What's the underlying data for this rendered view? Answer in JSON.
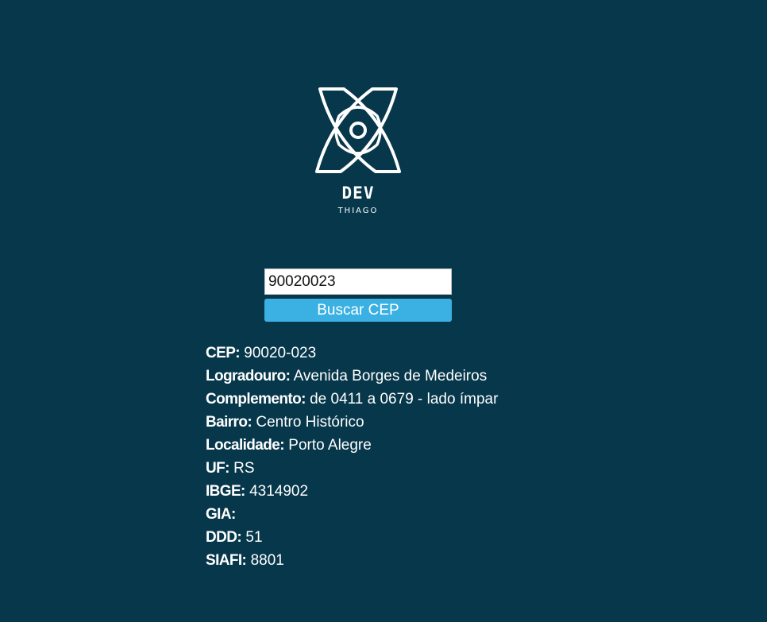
{
  "brand": {
    "name": "DEV",
    "subtitle": "THIAGO",
    "logo_icon": "atom-eye-icon"
  },
  "search": {
    "value": "90020023",
    "button_label": "Buscar CEP"
  },
  "result": [
    {
      "label": "CEP:",
      "value": "90020-023"
    },
    {
      "label": "Logradouro:",
      "value": "Avenida Borges de Medeiros"
    },
    {
      "label": "Complemento:",
      "value": "de 0411 a 0679 - lado ímpar"
    },
    {
      "label": "Bairro:",
      "value": "Centro Histórico"
    },
    {
      "label": "Localidade:",
      "value": "Porto Alegre"
    },
    {
      "label": "UF:",
      "value": "RS"
    },
    {
      "label": "IBGE:",
      "value": "4314902"
    },
    {
      "label": "GIA:",
      "value": ""
    },
    {
      "label": "DDD:",
      "value": "51"
    },
    {
      "label": "SIAFI:",
      "value": "8801"
    }
  ],
  "colors": {
    "background": "#07374b",
    "button": "#3bb1e3",
    "text": "#ffffff"
  }
}
